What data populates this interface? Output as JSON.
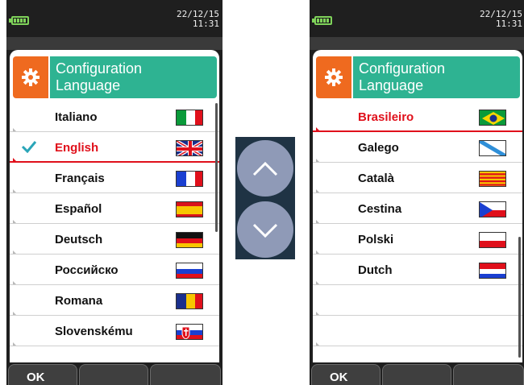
{
  "left": {
    "status": {
      "date": "22/12/15",
      "time": "11:31"
    },
    "header": {
      "line1": "Configuration",
      "line2": "Language"
    },
    "items": [
      {
        "label": "Italiano",
        "flag": "italy",
        "selected": false,
        "checked": false
      },
      {
        "label": "English",
        "flag": "uk",
        "selected": true,
        "checked": true
      },
      {
        "label": "Français",
        "flag": "france",
        "selected": false,
        "checked": false
      },
      {
        "label": "Español",
        "flag": "spain",
        "selected": false,
        "checked": false
      },
      {
        "label": "Deutsch",
        "flag": "germany",
        "selected": false,
        "checked": false
      },
      {
        "label": "Российско",
        "flag": "russia",
        "selected": false,
        "checked": false
      },
      {
        "label": "Romana",
        "flag": "romania",
        "selected": false,
        "checked": false
      },
      {
        "label": "Slovenskému",
        "flag": "slovakia",
        "selected": false,
        "checked": false
      }
    ],
    "softkeys": {
      "k1": "OK",
      "k2": "",
      "k3": ""
    }
  },
  "right": {
    "status": {
      "date": "22/12/15",
      "time": "11:31"
    },
    "header": {
      "line1": "Configuration",
      "line2": "Language"
    },
    "items": [
      {
        "label": "Brasileiro",
        "flag": "brazil",
        "selected": true,
        "checked": false
      },
      {
        "label": "Galego",
        "flag": "galicia",
        "selected": false,
        "checked": false
      },
      {
        "label": "Català",
        "flag": "catalonia",
        "selected": false,
        "checked": false
      },
      {
        "label": "Cestina",
        "flag": "czech",
        "selected": false,
        "checked": false
      },
      {
        "label": "Polski",
        "flag": "poland",
        "selected": false,
        "checked": false
      },
      {
        "label": "Dutch",
        "flag": "netherlands",
        "selected": false,
        "checked": false
      },
      {
        "label": "",
        "flag": "",
        "selected": false,
        "checked": false
      },
      {
        "label": "",
        "flag": "",
        "selected": false,
        "checked": false
      }
    ],
    "softkeys": {
      "k1": "OK",
      "k2": "",
      "k3": ""
    }
  },
  "icons": {
    "header": "gear-icon",
    "check": "checkmark-icon",
    "up": "arrow-up-icon",
    "down": "arrow-down-icon",
    "battery": "battery-icon"
  },
  "colors": {
    "accent_orange": "#ef6a1f",
    "accent_teal": "#2eb392",
    "selection_red": "#e0101b",
    "check_teal": "#2aa5b8",
    "battery_green": "#7fd35a",
    "arrow_panel": "#1f3344",
    "arrow_button": "#8f9ab7"
  }
}
